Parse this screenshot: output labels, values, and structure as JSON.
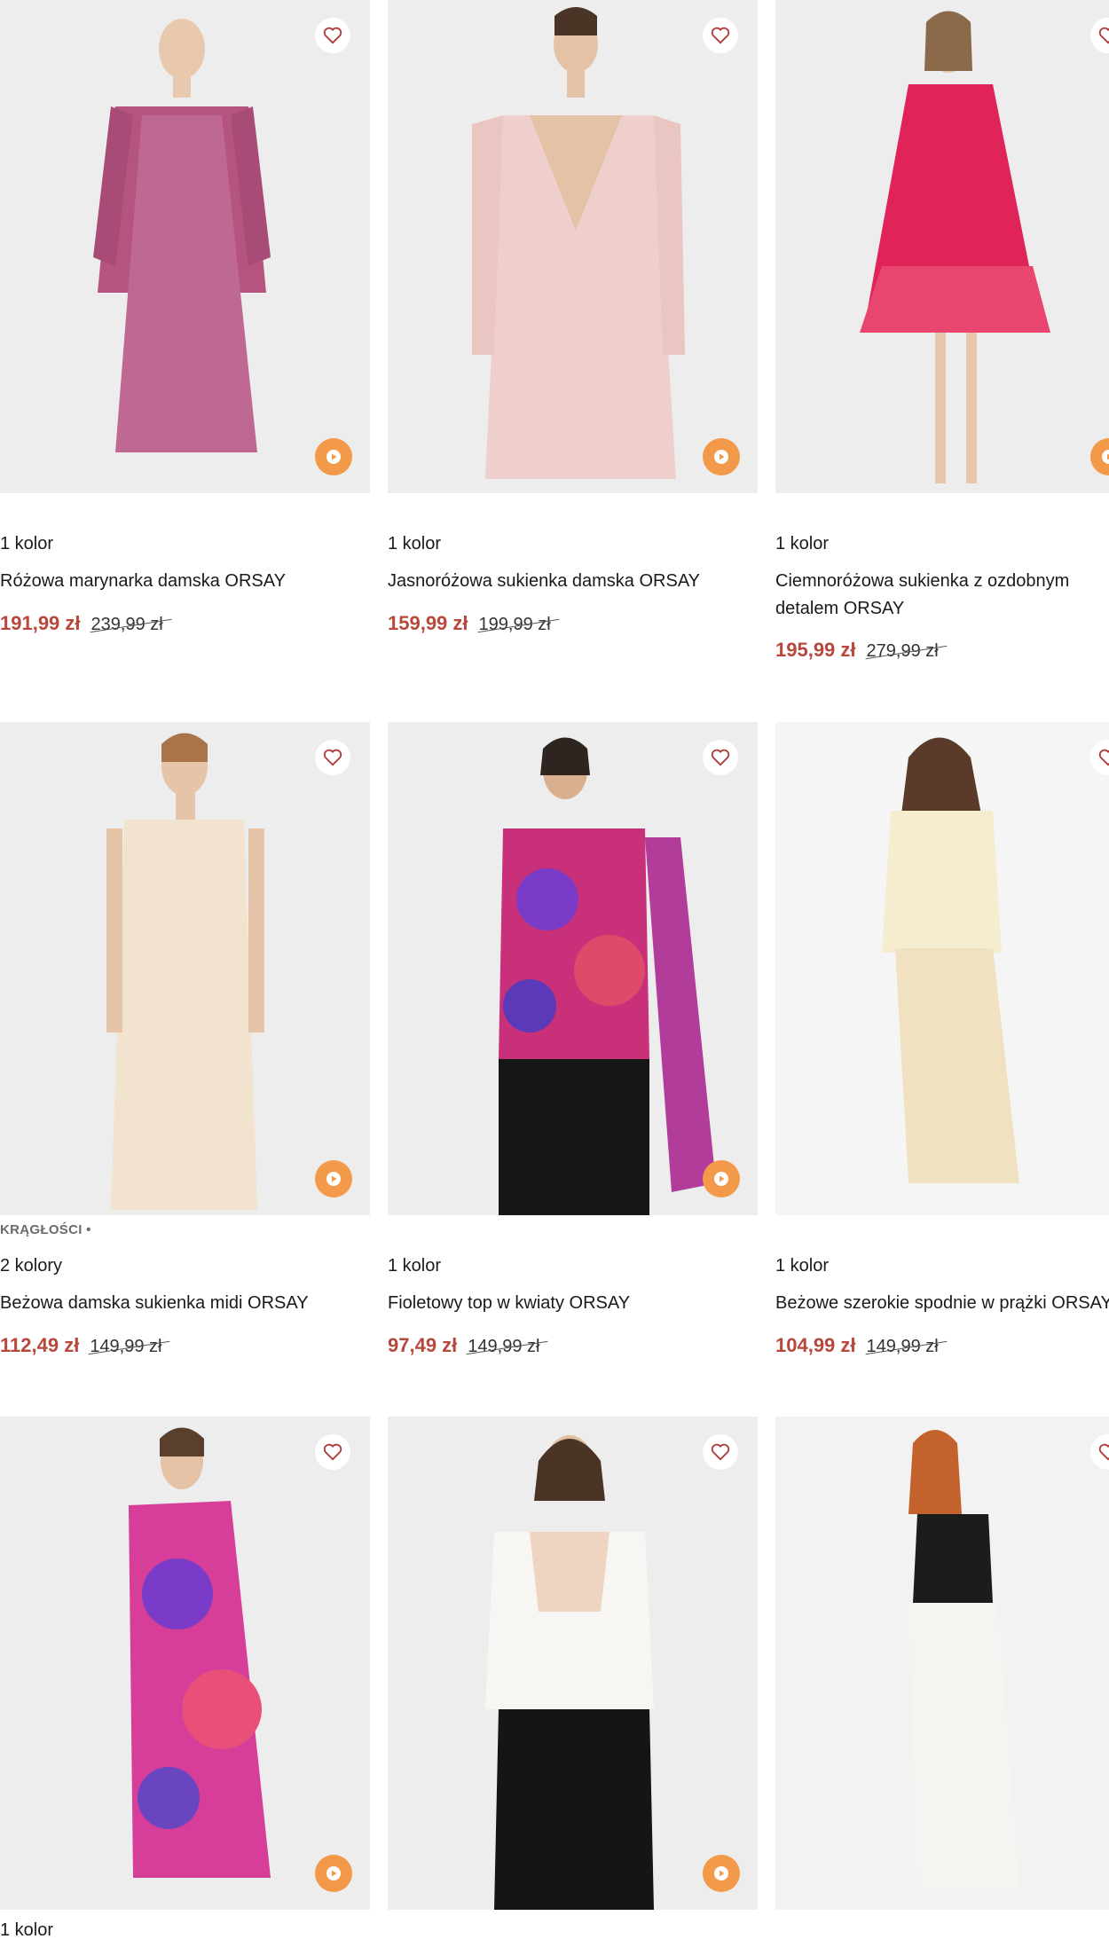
{
  "products": [
    {
      "colors": "1 kolor",
      "name": "Różowa marynarka damska ORSAY",
      "price": "191,99 zł",
      "old_price": "239,99 zł",
      "tag": ""
    },
    {
      "colors": "1 kolor",
      "name": "Jasnoróżowa sukienka damska ORSAY",
      "price": "159,99 zł",
      "old_price": "199,99 zł",
      "tag": ""
    },
    {
      "colors": "1 kolor",
      "name": "Ciemnoróżowa sukienka z ozdobnym detalem ORSAY",
      "price": "195,99 zł",
      "old_price": "279,99 zł",
      "tag": ""
    },
    {
      "colors": "2 kolory",
      "name": "Beżowa damska sukienka midi ORSAY",
      "price": "112,49 zł",
      "old_price": "149,99 zł",
      "tag": "KRĄGŁOŚCI •"
    },
    {
      "colors": "1 kolor",
      "name": "Fioletowy top w kwiaty ORSAY",
      "price": "97,49 zł",
      "old_price": "149,99 zł",
      "tag": ""
    },
    {
      "colors": "1 kolor",
      "name": "Beżowe szerokie spodnie w prążki ORSAY",
      "price": "104,99 zł",
      "old_price": "149,99 zł",
      "tag": ""
    },
    {
      "colors": "1 kolor",
      "name": "",
      "price": "",
      "old_price": "",
      "tag": ""
    },
    {
      "colors": "",
      "name": "",
      "price": "",
      "old_price": "",
      "tag": ""
    },
    {
      "colors": "",
      "name": "",
      "price": "",
      "old_price": "",
      "tag": ""
    }
  ],
  "icons": {
    "favorite": "heart-icon",
    "video": "play-icon"
  },
  "theme": {
    "price_color": "#b8473c",
    "play_button_color": "#f29a4a",
    "heart_color": "#b03a3a"
  }
}
